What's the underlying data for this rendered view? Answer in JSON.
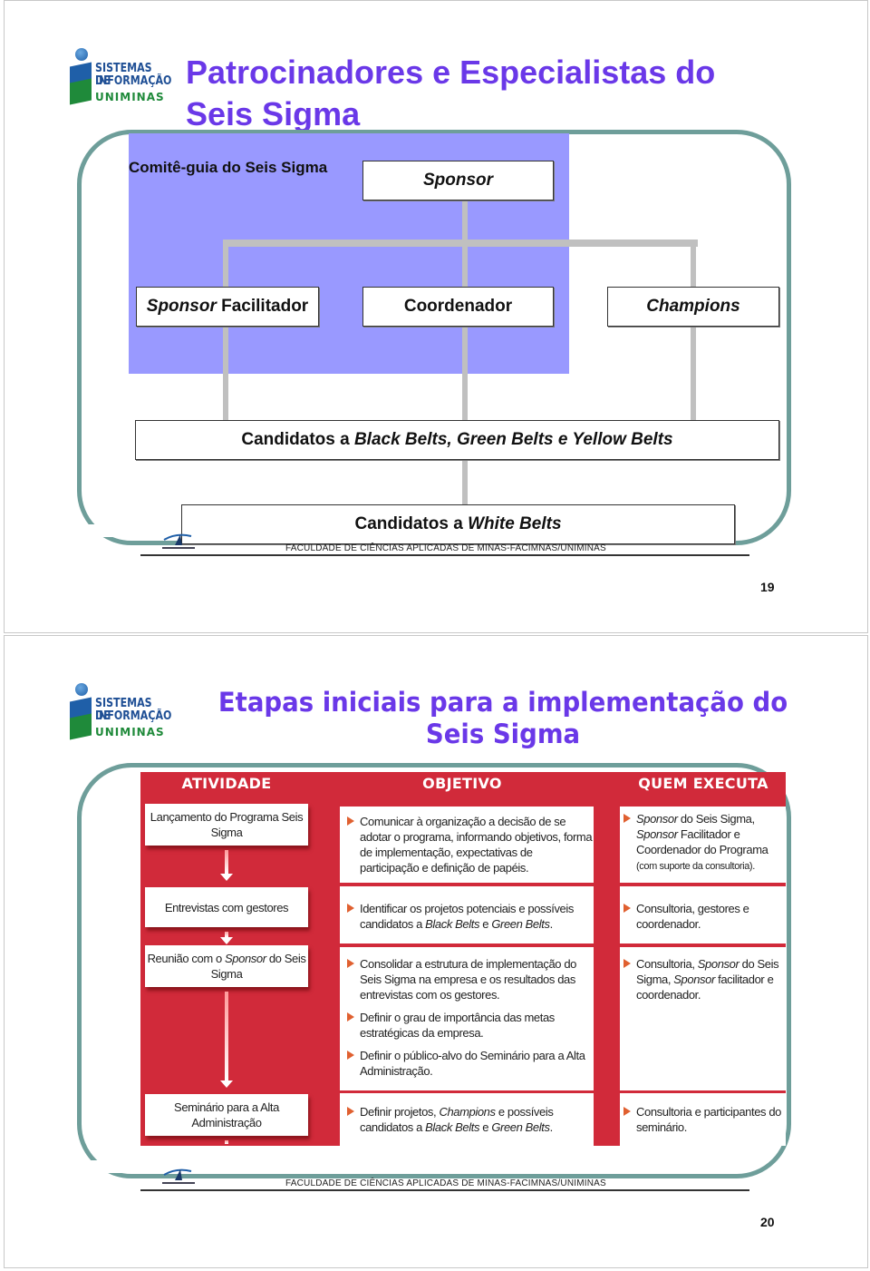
{
  "slide1": {
    "logo": {
      "line1": "SISTEMAS DE",
      "line2": "INFORMAÇÃO",
      "line3": "UNIMINAS"
    },
    "title": "Patrocinadores e Especialistas do Seis Sigma",
    "committee_label": "Comitê-guia do Seis Sigma",
    "boxes": {
      "sponsor": "Sponsor",
      "sponsor_facilitador_italic": "Sponsor",
      "sponsor_facilitador_rest": " Facilitador",
      "coordenador": "Coordenador",
      "champions": "Champions",
      "candidates_bgy_prefix": "Candidatos a ",
      "candidates_bgy_italic": "Black Belts, Green Belts e Yellow Belts",
      "candidates_white_prefix": "Candidatos a ",
      "candidates_white_italic": "White Belts"
    },
    "footer": "FACULDADE DE CIÊNCIAS APLICADAS DE MINAS-FACIMNAS/UNIMINAS",
    "page_number": "19"
  },
  "slide2": {
    "logo": {
      "line1": "SISTEMAS DE",
      "line2": "INFORMAÇÃO",
      "line3": "UNIMINAS"
    },
    "title": "Etapas iniciais para a implementação do Seis Sigma",
    "headers": [
      "ATIVIDADE",
      "OBJETIVO",
      "QUEM EXECUTA"
    ],
    "rows": [
      {
        "activity": "Lançamento do Programa Seis Sigma",
        "objectives": [
          "Comunicar à organização a decisão de se adotar o programa, informando objetivos, forma de implementação, expectativas de participação e definição de papéis."
        ],
        "executor_html": "<i>Sponsor</i> do Seis Sigma, <i>Sponsor</i> Facilitador e Coordenador do Programa <span class=\"small\">(com suporte da consultoria).</span>"
      },
      {
        "activity": "Entrevistas com gestores",
        "objectives_html": [
          "Identificar os projetos potenciais e possíveis candidatos a <i>Black Belts</i> e <i>Green Belts</i>."
        ],
        "executor_html": "Consultoria, gestores e coordenador."
      },
      {
        "activity_html": "Reunião com o <i>Sponsor</i> do Seis Sigma",
        "objectives": [
          "Consolidar a estrutura de implementação do Seis Sigma na empresa e os resultados das entrevistas com os gestores.",
          "Definir o grau de importância das metas estratégicas da empresa.",
          "Definir o público-alvo do Seminário para a Alta Administração."
        ],
        "executor_html": "Consultoria, <i>Sponsor</i> do Seis Sigma, <i>Sponsor</i> facilitador e coordenador."
      },
      {
        "activity": "Seminário para a Alta Administração",
        "objectives_html": [
          "Definir projetos, <i>Champions</i> e possíveis candidatos a <i>Black Belts</i> e <i>Green Belts</i>."
        ],
        "executor_html": "Consultoria e participantes do seminário."
      }
    ],
    "footer": "FACULDADE DE CIÊNCIAS APLICADAS DE MINAS-FACIMNAS/UNIMINAS",
    "page_number": "20"
  },
  "colors": {
    "title": "#6a38e8",
    "frame": "#6e9e9a",
    "committee_bg": "#9999ff",
    "table_red": "#d12a3a",
    "bullet": "#e06030"
  }
}
